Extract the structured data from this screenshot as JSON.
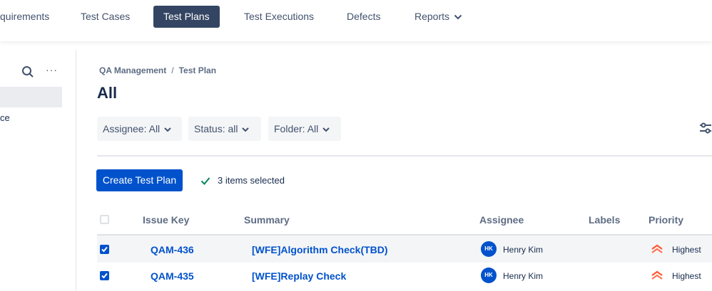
{
  "nav": {
    "items": [
      "quirements",
      "Test Cases",
      "Test Plans",
      "Test Executions",
      "Defects",
      "Reports"
    ],
    "active": "Test Plans"
  },
  "sidebar": {
    "partial_item": "ce",
    "more_label": "···"
  },
  "breadcrumb": {
    "project": "QA Management",
    "separator": "/",
    "page": "Test Plan"
  },
  "page": {
    "title": "All"
  },
  "filters": {
    "assignee": "Assignee: All",
    "status": "Status: all",
    "folder": "Folder: All"
  },
  "actions": {
    "create_label": "Create Test Plan",
    "selected_text": "3 items selected"
  },
  "table": {
    "columns": [
      "Issue Key",
      "Summary",
      "Assignee",
      "Labels",
      "Priority"
    ],
    "rows": [
      {
        "key": "QAM-436",
        "summary": "[WFE]Algorithm Check(TBD)",
        "initials": "HK",
        "assignee": "Henry Kim",
        "labels": "",
        "priority": "Highest",
        "checked": true
      },
      {
        "key": "QAM-435",
        "summary": "[WFE]Replay Check",
        "initials": "HK",
        "assignee": "Henry Kim",
        "labels": "",
        "priority": "Highest",
        "checked": true
      }
    ]
  },
  "colors": {
    "primary": "#0052cc",
    "nav_active": "#344563",
    "priority_highest": "#ff5630",
    "success": "#00875a"
  }
}
